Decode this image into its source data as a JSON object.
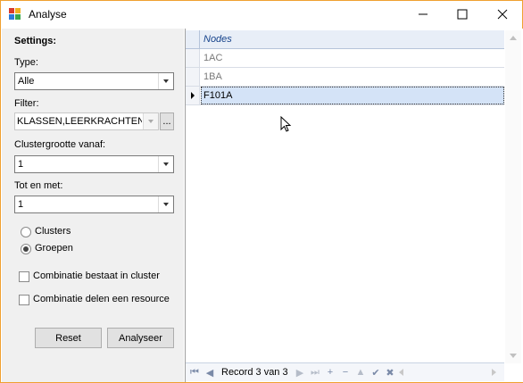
{
  "window": {
    "title": "Analyse",
    "minimize_glyph": "—",
    "maximize_glyph": "☐",
    "close_glyph": "✕"
  },
  "settings": {
    "heading": "Settings:",
    "type_label": "Type:",
    "type_value": "Alle",
    "filter_label": "Filter:",
    "filter_value": "KLASSEN,LEERKRACHTEN,...",
    "filter_browse": "...",
    "cluster_from_label": "Clustergrootte vanaf:",
    "cluster_from_value": "1",
    "cluster_to_label": "Tot en met:",
    "cluster_to_value": "1",
    "radio_clusters": "Clusters",
    "radio_groepen": "Groepen",
    "radio_selected": "Groepen",
    "check_cluster": "Combinatie bestaat in cluster",
    "check_resource": "Combinatie delen een resource",
    "reset_button": "Reset",
    "analyse_button": "Analyseer"
  },
  "grid": {
    "column_header": "Nodes",
    "rows": [
      {
        "value": "1AC"
      },
      {
        "value": "1BA"
      },
      {
        "value": "F101A"
      }
    ],
    "current_row": 3,
    "navigator_text": "Record 3 van 3"
  },
  "icons": {
    "app": "analyse-app-icon",
    "nav_first": "⏮",
    "nav_prev": "◀",
    "nav_next": "▶",
    "nav_last": "⏭",
    "nav_append": "+",
    "nav_delete": "−",
    "nav_up": "▲",
    "nav_ok": "✔",
    "nav_cancel": "✖"
  },
  "colors": {
    "window_border": "#f0a030",
    "panel_bg": "#f0f0f0",
    "grid_header_text": "#15428b",
    "selected_row_bg": "#d4e3f7"
  }
}
